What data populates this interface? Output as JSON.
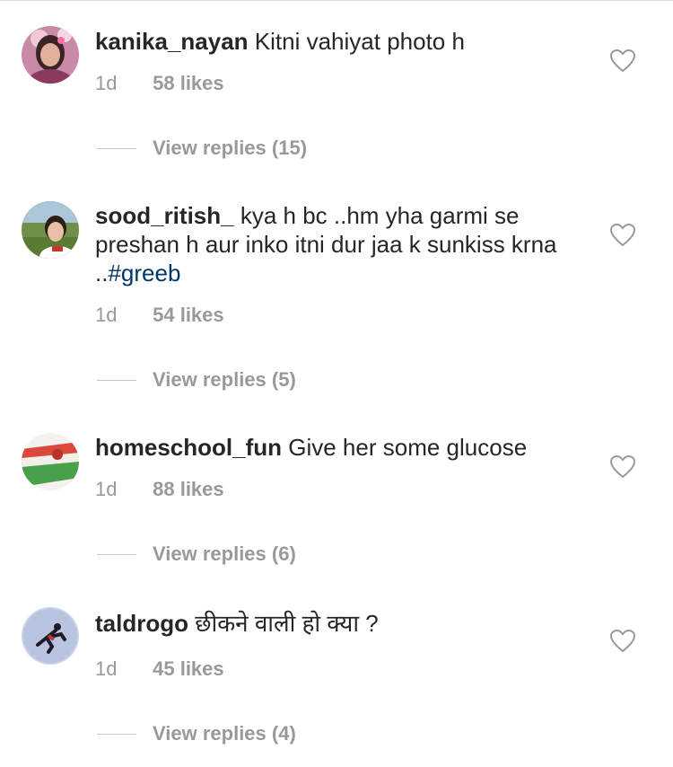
{
  "comments": [
    {
      "username": "kanika_nayan",
      "text": "Kitni vahiyat photo h",
      "hashtag": "",
      "age": "1d",
      "likes": "58 likes",
      "replies": "View replies (15)",
      "avatar_icon": "user-avatar-photo"
    },
    {
      "username": "sood_ritish_",
      "text": "kya h bc ..hm yha garmi se preshan h aur inko itni dur jaa k sunkiss krna ..",
      "hashtag": "#greeb",
      "age": "1d",
      "likes": "54 likes",
      "replies": "View replies (5)",
      "avatar_icon": "user-avatar-photo"
    },
    {
      "username": "homeschool_fun",
      "text": "Give her some glucose",
      "hashtag": "",
      "age": "1d",
      "likes": "88 likes",
      "replies": "View replies (6)",
      "avatar_icon": "user-avatar-photo"
    },
    {
      "username": "taldrogo",
      "text": "छीकने वाली हो क्या ?",
      "hashtag": "",
      "age": "1d",
      "likes": "45 likes",
      "replies": "View replies (4)",
      "avatar_icon": "user-avatar-photo"
    }
  ],
  "colors": {
    "text": "#262626",
    "secondary": "#999999",
    "hashtag": "#003569",
    "divider": "#dbdbdb"
  }
}
